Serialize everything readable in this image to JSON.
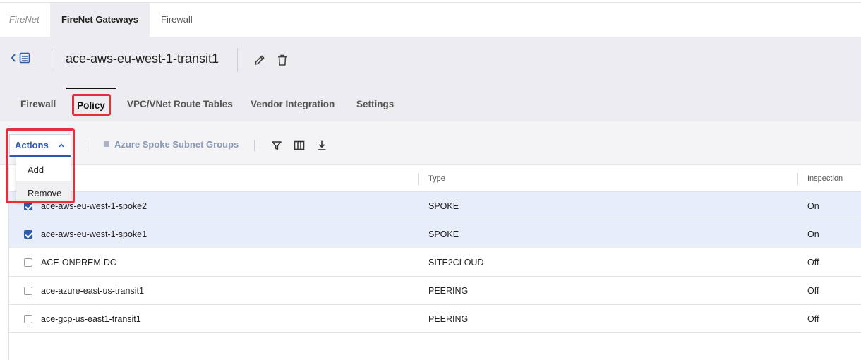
{
  "top_tabs": {
    "brand": "FireNet",
    "active": "FireNet Gateways",
    "firewall": "Firewall"
  },
  "header": {
    "gateway_name": "ace-aws-eu-west-1-transit1"
  },
  "sub_tabs": [
    "Firewall",
    "Policy",
    "VPC/VNet Route Tables",
    "Vendor Integration",
    "Settings"
  ],
  "toolbar": {
    "actions_label": "Actions",
    "azure_label": "Azure Spoke Subnet Groups"
  },
  "actions_menu": {
    "add": "Add",
    "remove": "Remove"
  },
  "table": {
    "columns": [
      "Type",
      "Inspection"
    ],
    "rows": [
      {
        "name": "ace-aws-eu-west-1-spoke2",
        "type": "SPOKE",
        "inspection": "On",
        "checked": true
      },
      {
        "name": "ace-aws-eu-west-1-spoke1",
        "type": "SPOKE",
        "inspection": "On",
        "checked": true
      },
      {
        "name": "ACE-ONPREM-DC",
        "type": "SITE2CLOUD",
        "inspection": "Off",
        "checked": false
      },
      {
        "name": "ace-azure-east-us-transit1",
        "type": "PEERING",
        "inspection": "Off",
        "checked": false
      },
      {
        "name": "ace-gcp-us-east1-transit1",
        "type": "PEERING",
        "inspection": "Off",
        "checked": false
      }
    ]
  },
  "colors": {
    "accent": "#2a5db0",
    "highlight": "#e2313a",
    "selected_row": "#e7eefa"
  }
}
